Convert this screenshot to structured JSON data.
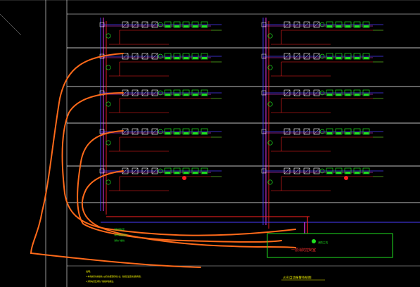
{
  "drawing": {
    "colors": {
      "background": "#000000",
      "frame": "#ffffff",
      "floor_line": "#ffffff",
      "bus_blue": "#4a3cff",
      "bus_magenta": "#ff3cff",
      "wire_red": "#ff2020",
      "device_white": "#ffffff",
      "device_green": "#20e020",
      "cable_orange": "#ff6a1a",
      "note_yellow": "#ffff00",
      "label_yellow": "#e8e800"
    },
    "icons": {
      "module": "square-with-diagonal",
      "detector": "green-rectangle-box",
      "bell": "bell-symbol",
      "sounder": "circle-symbol",
      "alarm": "red-dot-symbol"
    }
  },
  "labels": {
    "annotation_right": "一层消防控制室",
    "caption_bottom_right": "火灾自动报警系统图",
    "legend_lines": [
      "消防控制室",
      "消防电话总线",
      "消防广播线"
    ],
    "notes": [
      "说明：",
      "1.本系统采用总线制火灾自动报警控制方式，各楼层设置总线隔离器。",
      "2.消防电话及消防广播线单独敷设。"
    ],
    "box_label": "消防主机"
  }
}
